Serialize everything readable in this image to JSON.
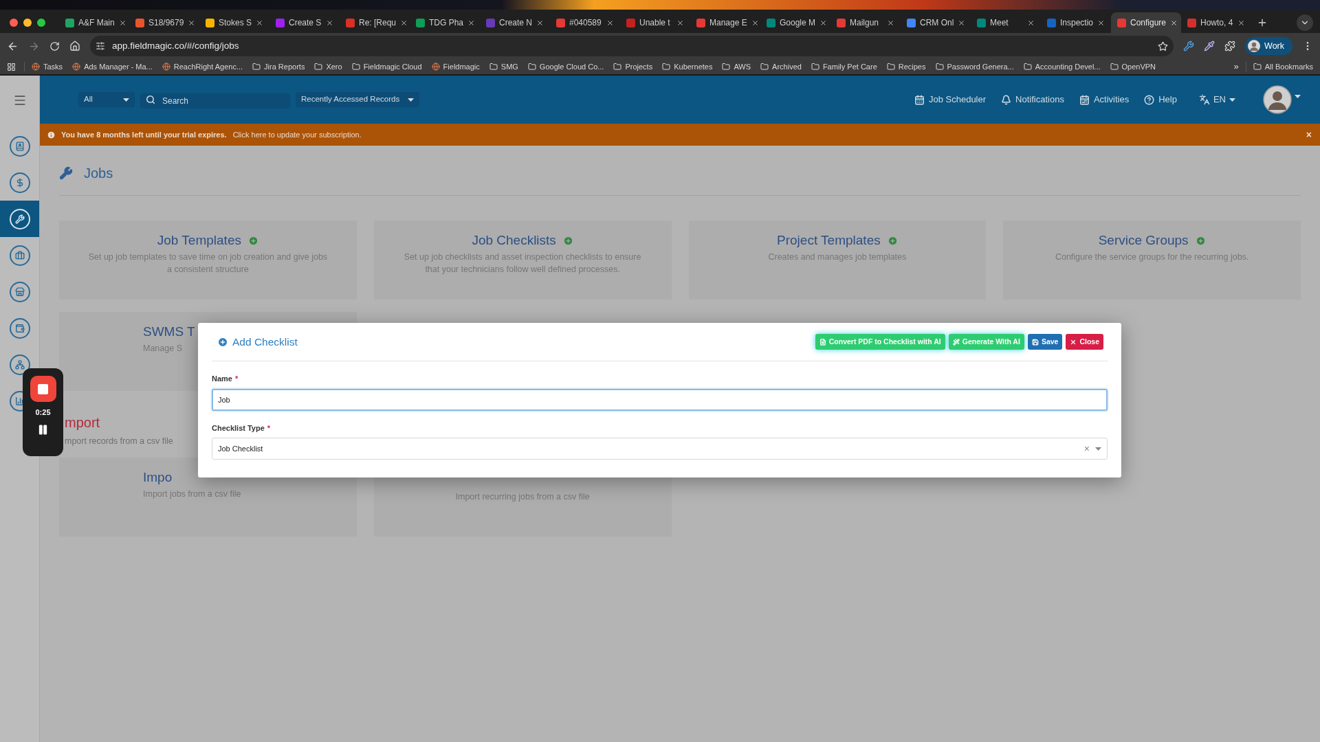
{
  "browser": {
    "tabs": [
      {
        "title": "A&F Main",
        "selected": false,
        "color": "#1fa463"
      },
      {
        "title": "S18/9679",
        "selected": false,
        "color": "#e8542c"
      },
      {
        "title": "Stokes S",
        "selected": false,
        "color": "#f4b400"
      },
      {
        "title": "Create S",
        "selected": false,
        "color": "#a020f0"
      },
      {
        "title": "Re: [Requ",
        "selected": false,
        "color": "#d93025"
      },
      {
        "title": "TDG Pha",
        "selected": false,
        "color": "#0f9d58"
      },
      {
        "title": "Create N",
        "selected": false,
        "color": "#673ab7"
      },
      {
        "title": "#040589",
        "selected": false,
        "color": "#e53935"
      },
      {
        "title": "Unable t",
        "selected": false,
        "color": "#c5221f"
      },
      {
        "title": "Manage E",
        "selected": false,
        "color": "#e53935"
      },
      {
        "title": "Google M",
        "selected": false,
        "color": "#00897b"
      },
      {
        "title": "Mailgun",
        "selected": false,
        "color": "#e53935"
      },
      {
        "title": "CRM Onl",
        "selected": false,
        "color": "#4285f4"
      },
      {
        "title": "Meet",
        "selected": false,
        "color": "#00897b"
      },
      {
        "title": "Inspectio",
        "selected": false,
        "color": "#1565c0"
      },
      {
        "title": "Configure",
        "selected": true,
        "color": "#e53935"
      },
      {
        "title": "Howto, 4",
        "selected": false,
        "color": "#d32f2f"
      }
    ],
    "url": "app.fieldmagic.co/#/config/jobs",
    "profile": "Work",
    "bookmarks": [
      {
        "label": "Tasks",
        "kind": "site"
      },
      {
        "label": "Ads Manager - Ma...",
        "kind": "site"
      },
      {
        "label": "ReachRight Agenc...",
        "kind": "site"
      },
      {
        "label": "Jira Reports",
        "kind": "folder"
      },
      {
        "label": "Xero",
        "kind": "folder"
      },
      {
        "label": "Fieldmagic Cloud",
        "kind": "folder"
      },
      {
        "label": "Fieldmagic",
        "kind": "site"
      },
      {
        "label": "SMG",
        "kind": "folder"
      },
      {
        "label": "Google Cloud Co...",
        "kind": "folder"
      },
      {
        "label": "Projects",
        "kind": "folder"
      },
      {
        "label": "Kubernetes",
        "kind": "folder"
      },
      {
        "label": "AWS",
        "kind": "folder"
      },
      {
        "label": "Archived",
        "kind": "folder"
      },
      {
        "label": "Family Pet Care",
        "kind": "folder"
      },
      {
        "label": "Recipes",
        "kind": "folder"
      },
      {
        "label": "Password Genera...",
        "kind": "folder"
      },
      {
        "label": "Accounting Devel...",
        "kind": "folder"
      },
      {
        "label": "OpenVPN",
        "kind": "folder"
      }
    ],
    "more": "»",
    "all_bookmarks": "All Bookmarks"
  },
  "topbar": {
    "scope": "All",
    "search_placeholder": "Search",
    "recent": "Recently Accessed Records",
    "links": [
      {
        "label": "Job Scheduler",
        "kind": "calendar"
      },
      {
        "label": "Notifications",
        "kind": "bell"
      },
      {
        "label": "Activities",
        "kind": "agenda"
      },
      {
        "label": "Help",
        "kind": "help"
      }
    ],
    "language": "EN"
  },
  "banner": {
    "message": "You have 8 months left until your trial expires.",
    "link": "Click here to update your subscription.",
    "close": "×"
  },
  "sidebar": {
    "items": [
      {
        "kind": "contacts",
        "selected": false
      },
      {
        "kind": "dollar",
        "selected": false
      },
      {
        "kind": "wrench",
        "selected": true
      },
      {
        "kind": "briefcase",
        "selected": false
      },
      {
        "kind": "store",
        "selected": false
      },
      {
        "kind": "wallet",
        "selected": false
      },
      {
        "kind": "network",
        "selected": false
      },
      {
        "kind": "chart",
        "selected": false
      }
    ]
  },
  "page": {
    "title": "Jobs",
    "cards": [
      {
        "kind": "full",
        "title": "Job Templates",
        "add": true,
        "description": "Set up job templates to save time on job creation and give jobs a consistent structure"
      },
      {
        "kind": "full",
        "title": "Job Checklists",
        "add": true,
        "description": "Set up job checklists and asset inspection checklists to ensure that your technicians follow well defined processes."
      },
      {
        "kind": "full",
        "title": "Project Templates",
        "add": true,
        "description": "Creates and manages job templates"
      },
      {
        "kind": "full",
        "title": "Service Groups",
        "add": true,
        "description": "Configure the service groups for the recurring jobs."
      }
    ],
    "more_cards": [
      {
        "kind": "cut",
        "title": "SWMS T",
        "description": "Manage S"
      }
    ],
    "import_section": {
      "title": "mport",
      "subtitle": "mport records from a csv file"
    },
    "import_cards": [
      {
        "kind": "cut",
        "title": "Impo",
        "description": "Import jobs from a csv file"
      },
      {
        "kind": "full",
        "description": "Import recurring jobs from a csv file"
      }
    ]
  },
  "modal": {
    "title": "Add Checklist",
    "actions": [
      {
        "label": "Convert PDF to Checklist with AI",
        "kind": "pdf"
      },
      {
        "label": "Generate With AI",
        "kind": "generate"
      },
      {
        "label": "Save",
        "kind": "save"
      },
      {
        "label": "Close",
        "kind": "close"
      }
    ],
    "fields": [
      {
        "label": "Name",
        "required_mark": "*",
        "kind": "text",
        "value": "Job",
        "focused": true
      },
      {
        "label": "Checklist Type",
        "required_mark": "*",
        "kind": "select",
        "value": "Job Checklist",
        "clear": "×",
        "focused": false
      }
    ]
  },
  "recorder": {
    "time": "0:25"
  }
}
